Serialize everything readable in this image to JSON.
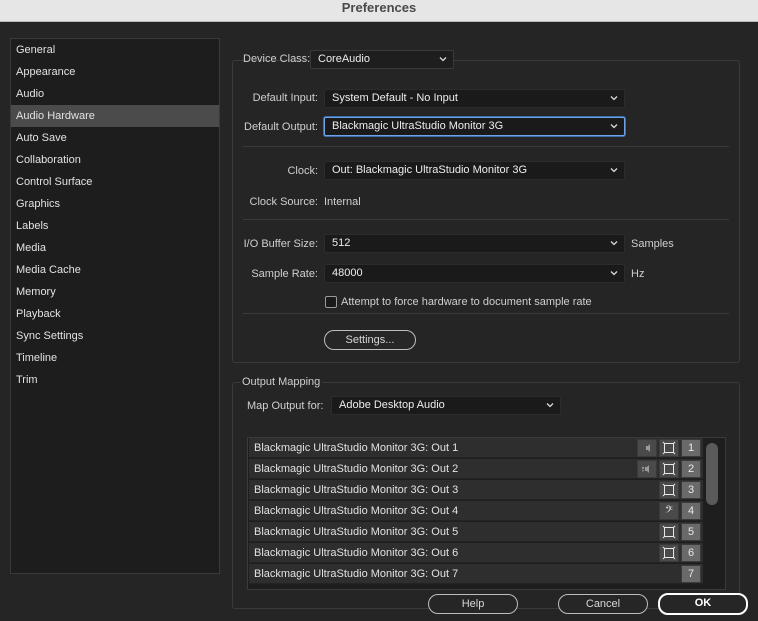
{
  "window": {
    "title": "Preferences"
  },
  "sidebar": {
    "items": [
      {
        "label": "General"
      },
      {
        "label": "Appearance"
      },
      {
        "label": "Audio"
      },
      {
        "label": "Audio Hardware",
        "selected": true
      },
      {
        "label": "Auto Save"
      },
      {
        "label": "Collaboration"
      },
      {
        "label": "Control Surface"
      },
      {
        "label": "Graphics"
      },
      {
        "label": "Labels"
      },
      {
        "label": "Media"
      },
      {
        "label": "Media Cache"
      },
      {
        "label": "Memory"
      },
      {
        "label": "Playback"
      },
      {
        "label": "Sync Settings"
      },
      {
        "label": "Timeline"
      },
      {
        "label": "Trim"
      }
    ]
  },
  "device": {
    "class_label": "Device Class:",
    "class_value": "CoreAudio",
    "input_label": "Default Input:",
    "input_value": "System Default - No Input",
    "output_label": "Default Output:",
    "output_value": "Blackmagic UltraStudio Monitor 3G",
    "clock_label": "Clock:",
    "clock_value": "Out: Blackmagic UltraStudio Monitor 3G",
    "clock_source_label": "Clock Source:",
    "clock_source_value": "Internal",
    "buffer_label": "I/O Buffer Size:",
    "buffer_value": "512",
    "buffer_unit": "Samples",
    "rate_label": "Sample Rate:",
    "rate_value": "48000",
    "rate_unit": "Hz",
    "force_rate_label": "Attempt to force hardware to document sample rate",
    "force_rate_checked": false,
    "settings_button": "Settings..."
  },
  "output_mapping": {
    "section_label": "Output Mapping",
    "map_for_label": "Map Output for:",
    "map_for_value": "Adobe Desktop Audio",
    "rows": [
      {
        "name": "Blackmagic UltraStudio Monitor 3G: Out 1",
        "icons": [
          "speaker-left-icon",
          "screen-icon"
        ],
        "channel": "1"
      },
      {
        "name": "Blackmagic UltraStudio Monitor 3G: Out 2",
        "icons": [
          "speaker-right-icon",
          "screen-icon"
        ],
        "channel": "2"
      },
      {
        "name": "Blackmagic UltraStudio Monitor 3G: Out 3",
        "icons": [
          "screen-icon"
        ],
        "channel": "3"
      },
      {
        "name": "Blackmagic UltraStudio Monitor 3G: Out 4",
        "icons": [
          "bass-clef-icon"
        ],
        "channel": "4"
      },
      {
        "name": "Blackmagic UltraStudio Monitor 3G: Out 5",
        "icons": [
          "screen-icon"
        ],
        "channel": "5"
      },
      {
        "name": "Blackmagic UltraStudio Monitor 3G: Out 6",
        "icons": [
          "screen-icon"
        ],
        "channel": "6"
      },
      {
        "name": "Blackmagic UltraStudio Monitor 3G: Out 7",
        "icons": [],
        "channel": "7"
      }
    ]
  },
  "footer": {
    "help_button": "Help",
    "cancel_button": "Cancel",
    "ok_button": "OK"
  }
}
